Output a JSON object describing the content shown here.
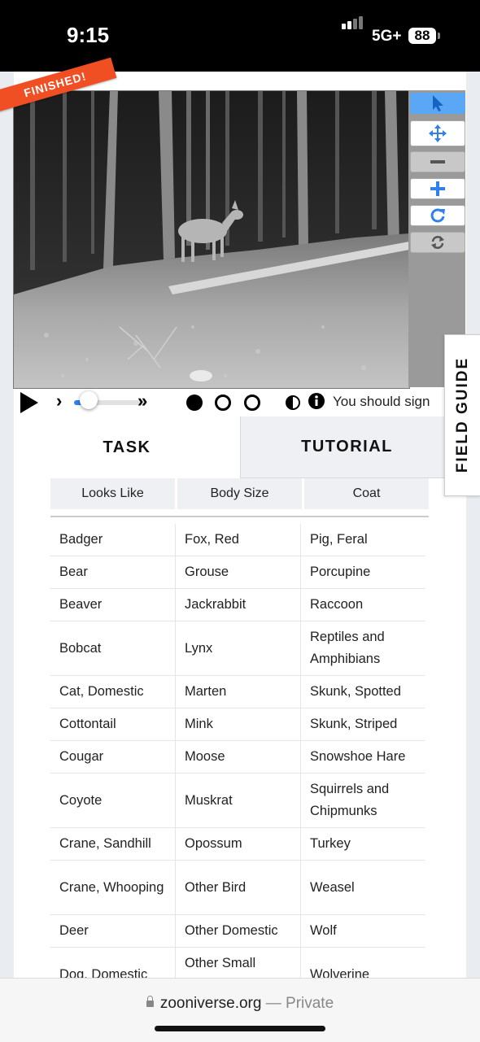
{
  "status_bar": {
    "time": "9:15",
    "network": "5G+",
    "battery": "88"
  },
  "subject": {
    "badge": "FINISHED!"
  },
  "toolbar": {
    "tools": [
      {
        "name": "select-icon",
        "active": true
      },
      {
        "name": "move-icon",
        "active": false
      },
      {
        "name": "zoom-out-icon",
        "active": false,
        "disabled": true
      },
      {
        "name": "zoom-in-icon",
        "active": false
      },
      {
        "name": "rotate-icon",
        "active": false
      },
      {
        "name": "reset-icon",
        "active": false,
        "disabled": true
      }
    ]
  },
  "controls": {
    "speed_value": 0.2,
    "frames": [
      "filled",
      "empty",
      "empty"
    ],
    "message": "You should sign"
  },
  "tabs": [
    {
      "label": "TASK",
      "active": true
    },
    {
      "label": "TUTORIAL",
      "active": false
    }
  ],
  "field_guide": {
    "label": "FIELD GUIDE"
  },
  "filters": [
    "Looks Like",
    "Body Size",
    "Coat"
  ],
  "species_columns": [
    [
      "Badger",
      "Bear",
      "Beaver",
      "Bobcat",
      "Cat, Domestic",
      "Cottontail",
      "Cougar",
      "Coyote",
      "Crane, Sandhill",
      "Crane, Whooping",
      "Deer",
      "Dog, Domestic"
    ],
    [
      "Fox, Red",
      "Grouse",
      "Jackrabbit",
      "Lynx",
      "Marten",
      "Mink",
      "Moose",
      "Muskrat",
      "Opossum",
      "Other Bird",
      "Other Domestic",
      "Other Small Mammal"
    ],
    [
      "Pig, Feral",
      "Porcupine",
      "Raccoon",
      "Reptiles and Amphibians",
      "Skunk, Spotted",
      "Skunk, Striped",
      "Snowshoe Hare",
      "Squirrels and Chipmunks",
      "Turkey",
      "Weasel",
      "Wolf",
      "Wolverine"
    ]
  ],
  "browser": {
    "domain": "zooniverse.org",
    "separator": "—",
    "mode": "Private"
  },
  "colors": {
    "accent": "#2f80ed",
    "ribbon": "#f04e23",
    "active_tool": "#5aa8f5"
  }
}
